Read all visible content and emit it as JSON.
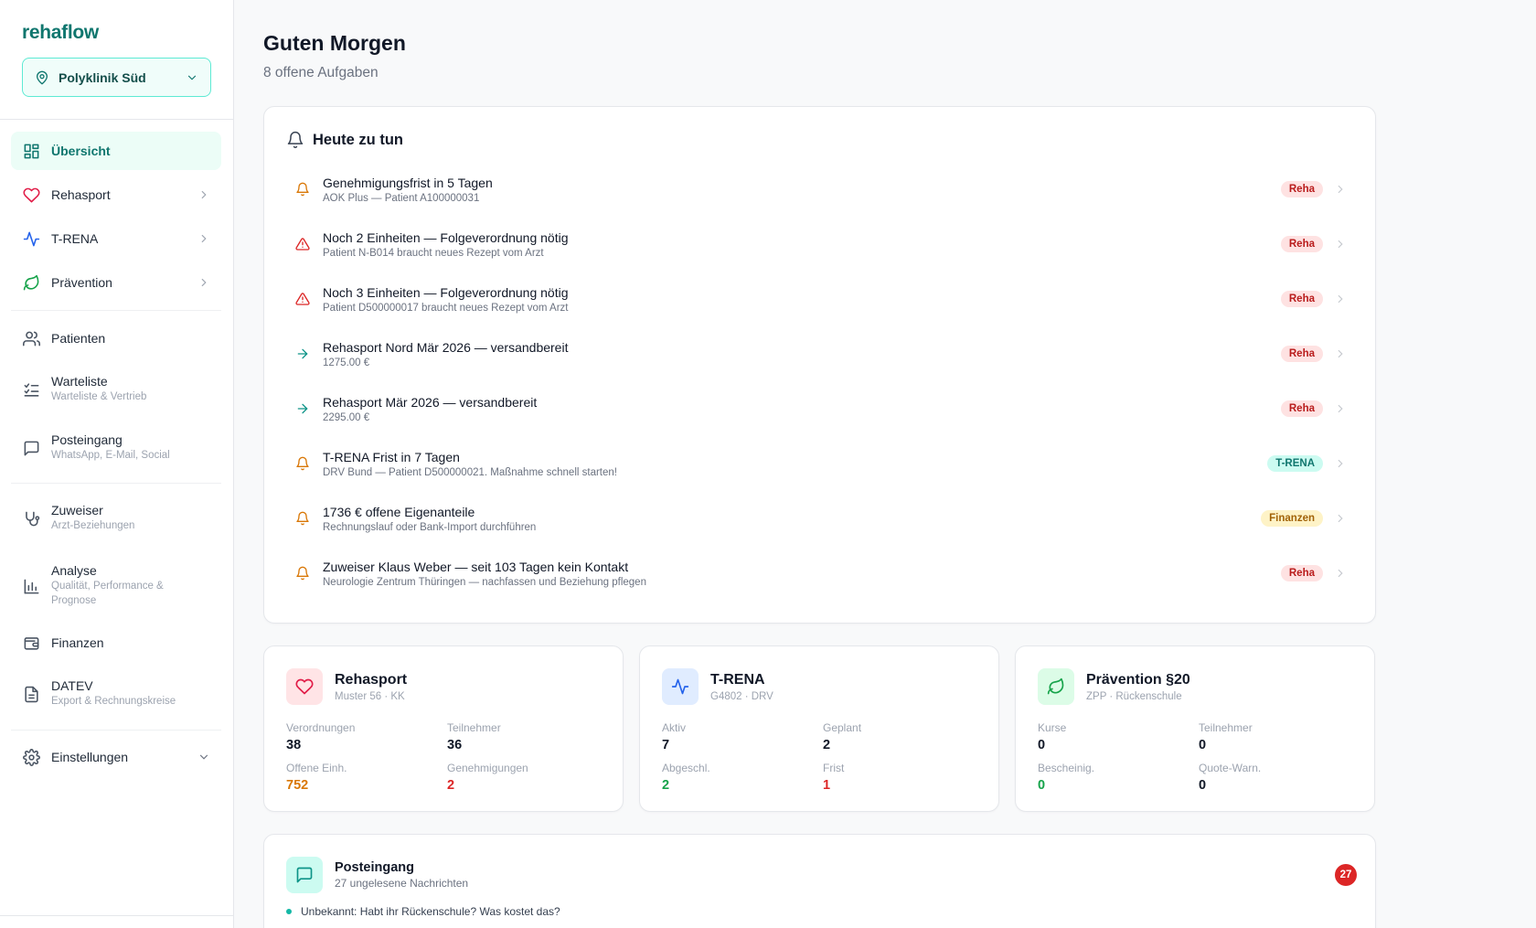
{
  "brand": "rehaflow",
  "location": {
    "label": "Polyklinik Süd"
  },
  "nav": {
    "items": [
      {
        "label": "Übersicht"
      },
      {
        "label": "Rehasport"
      },
      {
        "label": "T-RENA"
      },
      {
        "label": "Prävention"
      },
      {
        "label": "Patienten"
      },
      {
        "label": "Warteliste",
        "sub": "Warteliste & Vertrieb"
      },
      {
        "label": "Posteingang",
        "sub": "WhatsApp, E-Mail, Social"
      },
      {
        "label": "Zuweiser",
        "sub": "Arzt-Beziehungen"
      },
      {
        "label": "Analyse",
        "sub": "Qualität, Performance & Prognose"
      },
      {
        "label": "Finanzen"
      },
      {
        "label": "DATEV",
        "sub": "Export & Rechnungskreise"
      },
      {
        "label": "Einstellungen"
      }
    ]
  },
  "header": {
    "title": "Guten Morgen",
    "subtitle": "8 offene Aufgaben"
  },
  "todo": {
    "title": "Heute zu tun",
    "tasks": [
      {
        "title": "Genehmigungsfrist in 5 Tagen",
        "sub": "AOK Plus — Patient A100000031",
        "badge": "Reha",
        "icon": "bell-icon"
      },
      {
        "title": "Noch 2 Einheiten — Folgeverordnung nötig",
        "sub": "Patient N-B014 braucht neues Rezept vom Arzt",
        "badge": "Reha",
        "icon": "warning-icon"
      },
      {
        "title": "Noch 3 Einheiten — Folgeverordnung nötig",
        "sub": "Patient D500000017 braucht neues Rezept vom Arzt",
        "badge": "Reha",
        "icon": "warning-icon"
      },
      {
        "title": "Rehasport Nord Mär 2026 — versandbereit",
        "sub": "1275.00 €",
        "badge": "Reha",
        "icon": "arrow-right-icon"
      },
      {
        "title": "Rehasport Mär 2026 — versandbereit",
        "sub": "2295.00 €",
        "badge": "Reha",
        "icon": "arrow-right-icon"
      },
      {
        "title": "T-RENA Frist in 7 Tagen",
        "sub": "DRV Bund — Patient D500000021. Maßnahme schnell starten!",
        "badge": "T-RENA",
        "icon": "bell-icon"
      },
      {
        "title": "1736 € offene Eigenanteile",
        "sub": "Rechnungslauf oder Bank-Import durchführen",
        "badge": "Finanzen",
        "icon": "bell-icon"
      },
      {
        "title": "Zuweiser Klaus Weber — seit 103 Tagen kein Kontakt",
        "sub": "Neurologie Zentrum Thüringen — nachfassen und Beziehung pflegen",
        "badge": "Reha",
        "icon": "bell-icon"
      }
    ]
  },
  "modules": [
    {
      "title": "Rehasport",
      "sub": "Muster 56 · KK",
      "icon": "heart-icon",
      "stats": [
        {
          "label": "Verordnungen",
          "value": "38"
        },
        {
          "label": "Teilnehmer",
          "value": "36"
        },
        {
          "label": "Offene Einh.",
          "value": "752"
        },
        {
          "label": "Genehmigungen",
          "value": "2"
        }
      ]
    },
    {
      "title": "T-RENA",
      "sub": "G4802 · DRV",
      "icon": "activity-icon",
      "stats": [
        {
          "label": "Aktiv",
          "value": "7"
        },
        {
          "label": "Geplant",
          "value": "2"
        },
        {
          "label": "Abgeschl.",
          "value": "2"
        },
        {
          "label": "Frist",
          "value": "1"
        }
      ]
    },
    {
      "title": "Prävention §20",
      "sub": "ZPP · Rückenschule",
      "icon": "leaf-icon",
      "stats": [
        {
          "label": "Kurse",
          "value": "0"
        },
        {
          "label": "Teilnehmer",
          "value": "0"
        },
        {
          "label": "Bescheinig.",
          "value": "0"
        },
        {
          "label": "Quote-Warn.",
          "value": "0"
        }
      ]
    }
  ],
  "inbox": {
    "title": "Posteingang",
    "sub": "27 ungelesene Nachrichten",
    "count": "27",
    "message": "Unbekannt: Habt ihr Rückenschule? Was kostet das?"
  },
  "colors": {
    "accent": "#0f766e",
    "reha_badge": "#fee2e2",
    "trena_badge": "#ccfbf1",
    "finanzen_badge": "#fef3c7",
    "orange_value": "#d97706",
    "red_value": "#dc2626",
    "green_value": "#16a34a"
  }
}
